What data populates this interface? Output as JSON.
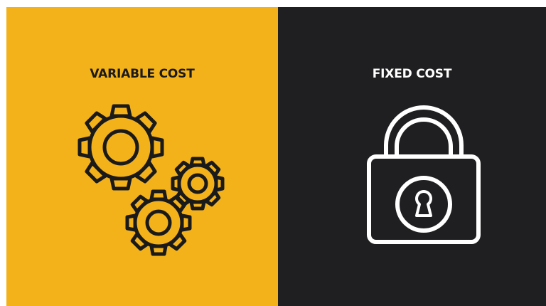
{
  "panels": {
    "left": {
      "title": "VARIABLE COST",
      "icon": "gears-icon",
      "background": "#f4b21a",
      "ink": "#1a1a1a"
    },
    "right": {
      "title": "FIXED COST",
      "icon": "padlock-icon",
      "background": "#1f1f21",
      "ink": "#ffffff"
    }
  }
}
